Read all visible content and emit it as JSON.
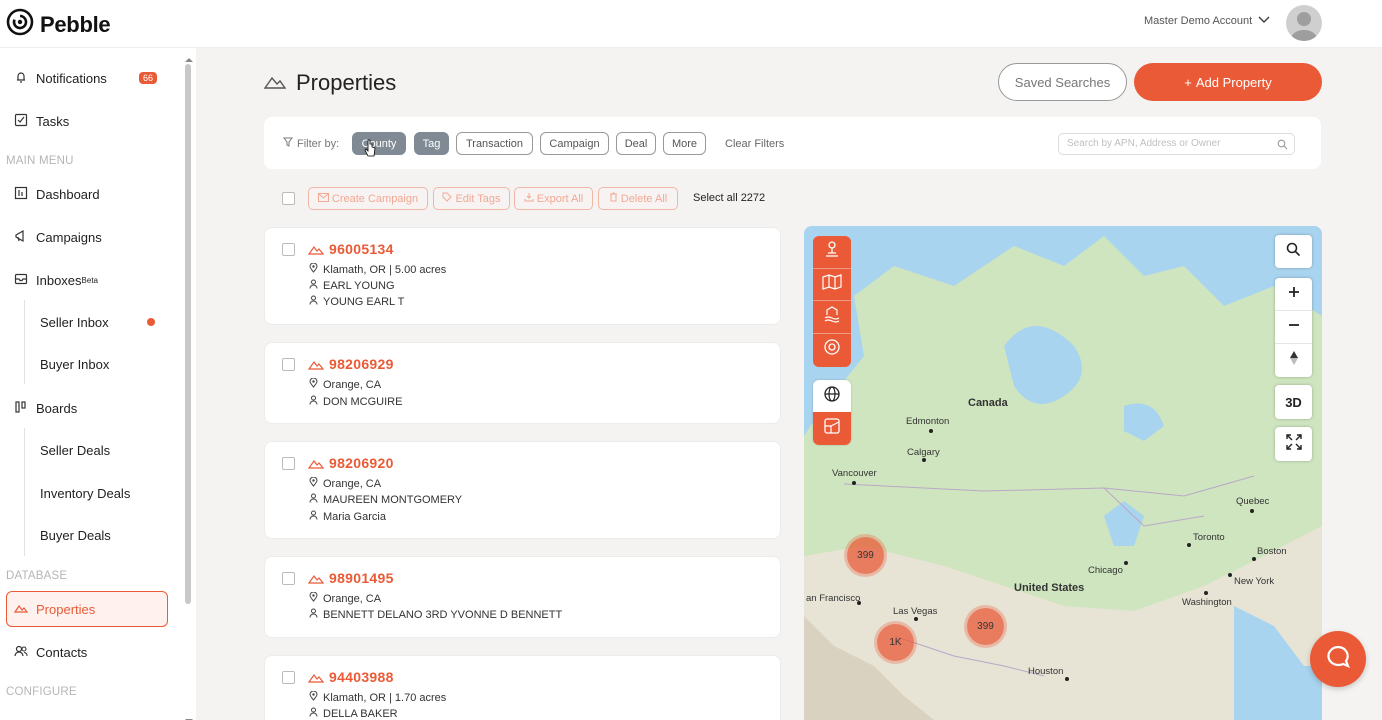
{
  "app": {
    "name": "Pebble",
    "account": "Master Demo Account"
  },
  "sidebar": {
    "notifications": {
      "label": "Notifications",
      "badge": "66"
    },
    "tasks": "Tasks",
    "sections": {
      "main_menu": "MAIN MENU",
      "database": "DATABASE",
      "configure": "CONFIGURE"
    },
    "dashboard": "Dashboard",
    "campaigns": "Campaigns",
    "inboxes": {
      "label": "Inboxes",
      "sup": "Beta"
    },
    "seller_inbox": "Seller Inbox",
    "buyer_inbox": "Buyer Inbox",
    "boards": "Boards",
    "seller_deals": "Seller Deals",
    "inventory_deals": "Inventory Deals",
    "buyer_deals": "Buyer Deals",
    "properties": "Properties",
    "contacts": "Contacts"
  },
  "page": {
    "title": "Properties",
    "saved_searches": "Saved Searches",
    "add_property": "Add Property"
  },
  "filters": {
    "label": "Filter by:",
    "chips": [
      "County",
      "Tag",
      "Transaction",
      "Campaign",
      "Deal",
      "More"
    ],
    "clear": "Clear Filters",
    "search_placeholder": "Search by APN, Address or Owner"
  },
  "bulk": {
    "create_campaign": "Create Campaign",
    "edit_tags": "Edit Tags",
    "export_all": "Export All",
    "delete_all": "Delete All",
    "select_all": "Select all 2272"
  },
  "properties": [
    {
      "apn": "96005134",
      "location": "Klamath, OR | 5.00 acres",
      "owners": [
        "EARL YOUNG",
        "YOUNG EARL T"
      ]
    },
    {
      "apn": "98206929",
      "location": "Orange, CA",
      "owners": [
        "DON MCGUIRE"
      ]
    },
    {
      "apn": "98206920",
      "location": "Orange, CA",
      "owners": [
        "MAUREEN MONTGOMERY",
        "Maria Garcia"
      ]
    },
    {
      "apn": "98901495",
      "location": "Orange, CA",
      "owners": [
        "BENNETT DELANO 3RD YVONNE D BENNETT"
      ]
    },
    {
      "apn": "94403988",
      "location": "Klamath, OR | 1.70 acres",
      "owners": [
        "DELLA BAKER"
      ]
    }
  ],
  "map": {
    "btn_3d": "3D",
    "labels": {
      "canada": "Canada",
      "edmonton": "Edmonton",
      "calgary": "Calgary",
      "vancouver": "Vancouver",
      "quebec": "Quebec",
      "toronto": "Toronto",
      "boston": "Boston",
      "new_york": "New York",
      "washington": "Washington",
      "chicago": "Chicago",
      "united_states": "United States",
      "san_francisco": "an Francisco",
      "las_vegas": "Las Vegas",
      "houston": "Houston"
    },
    "clusters": {
      "c1": "399",
      "c2": "1K",
      "c3": "399"
    }
  }
}
